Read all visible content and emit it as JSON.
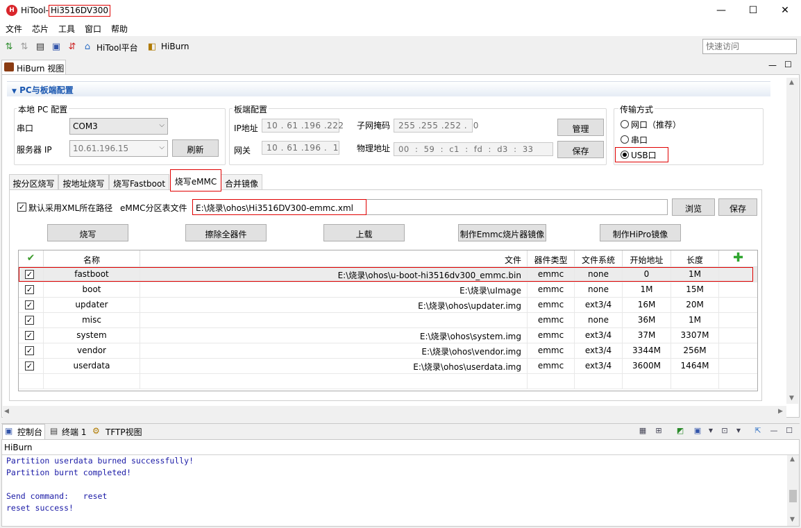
{
  "window": {
    "title_prefix": "HiTool-",
    "title_device": "Hi3516DV300",
    "logo": "H",
    "minimize": "—",
    "maximize": "☐",
    "close": "✕"
  },
  "menu": [
    "文件",
    "芯片",
    "工具",
    "窗口",
    "帮助"
  ],
  "toolbar": {
    "hitool_platform": "HiTool平台",
    "hiburn": "HiBurn",
    "quick_access_placeholder": "快速访问"
  },
  "view_tab": {
    "label": "HiBurn 视图"
  },
  "section": {
    "title": "PC与板端配置"
  },
  "local_pc": {
    "group": "本地 PC 配置",
    "serial_label": "串口",
    "serial_value": "COM3",
    "server_ip_label": "服务器 IP",
    "server_ip_value": "10.61.196.15",
    "refresh": "刷新"
  },
  "board": {
    "group": "板端配置",
    "ip_label": "IP地址",
    "ip_value": "10 . 61 .196 .222",
    "gateway_label": "网关",
    "gateway_value": "10 . 61 .196 .  1",
    "subnet_label": "子网掩码",
    "subnet_value": "255 .255 .252 .  0",
    "mac_label": "物理地址",
    "mac_value": "00  :  59  :  c1  :  fd  :  d3  :  33",
    "manage": "管理",
    "save": "保存"
  },
  "transfer": {
    "group": "传输方式",
    "options": [
      "网口（推荐）",
      "串口",
      "USB口"
    ],
    "selected": "USB口"
  },
  "tabs": [
    "按分区烧写",
    "按地址烧写",
    "烧写Fastboot",
    "烧写eMMC",
    "合并镜像"
  ],
  "active_tab": "烧写eMMC",
  "emmc": {
    "use_default_xml": "默认采用XML所在路径",
    "partition_file_label": "eMMC分区表文件",
    "partition_file_path": "E:\\烧录\\ohos\\Hi3516DV300-emmc.xml",
    "browse": "浏览",
    "save": "保存",
    "burn": "烧写",
    "erase_all": "擦除全器件",
    "upload": "上载",
    "make_emmc_image": "制作Emmc烧片器镜像",
    "make_hipro_image": "制作HiPro镜像"
  },
  "table": {
    "headers": [
      "名称",
      "文件",
      "器件类型",
      "文件系统",
      "开始地址",
      "长度"
    ],
    "rows": [
      {
        "name": "fastboot",
        "file": "E:\\烧录\\ohos\\u-boot-hi3516dv300_emmc.bin",
        "device": "emmc",
        "fs": "none",
        "start": "0",
        "length": "1M"
      },
      {
        "name": "boot",
        "file": "E:\\烧录\\uImage",
        "device": "emmc",
        "fs": "none",
        "start": "1M",
        "length": "15M"
      },
      {
        "name": "updater",
        "file": "E:\\烧录\\ohos\\updater.img",
        "device": "emmc",
        "fs": "ext3/4",
        "start": "16M",
        "length": "20M"
      },
      {
        "name": "misc",
        "file": "",
        "device": "emmc",
        "fs": "none",
        "start": "36M",
        "length": "1M"
      },
      {
        "name": "system",
        "file": "E:\\烧录\\ohos\\system.img",
        "device": "emmc",
        "fs": "ext3/4",
        "start": "37M",
        "length": "3307M"
      },
      {
        "name": "vendor",
        "file": "E:\\烧录\\ohos\\vendor.img",
        "device": "emmc",
        "fs": "ext3/4",
        "start": "3344M",
        "length": "256M"
      },
      {
        "name": "userdata",
        "file": "E:\\烧录\\ohos\\userdata.img",
        "device": "emmc",
        "fs": "ext3/4",
        "start": "3600M",
        "length": "1464M"
      }
    ]
  },
  "console": {
    "tabs": [
      "控制台",
      "终端 1",
      "TFTP视图"
    ],
    "source": "HiBurn",
    "lines": [
      "Partition userdata burned successfully!",
      "Partition burnt completed!",
      "",
      "Send command:   reset",
      "reset success!"
    ]
  },
  "colors": {
    "accent": "#1a57b0",
    "highlight": "#e00000",
    "console_text": "#1a1aa6"
  }
}
